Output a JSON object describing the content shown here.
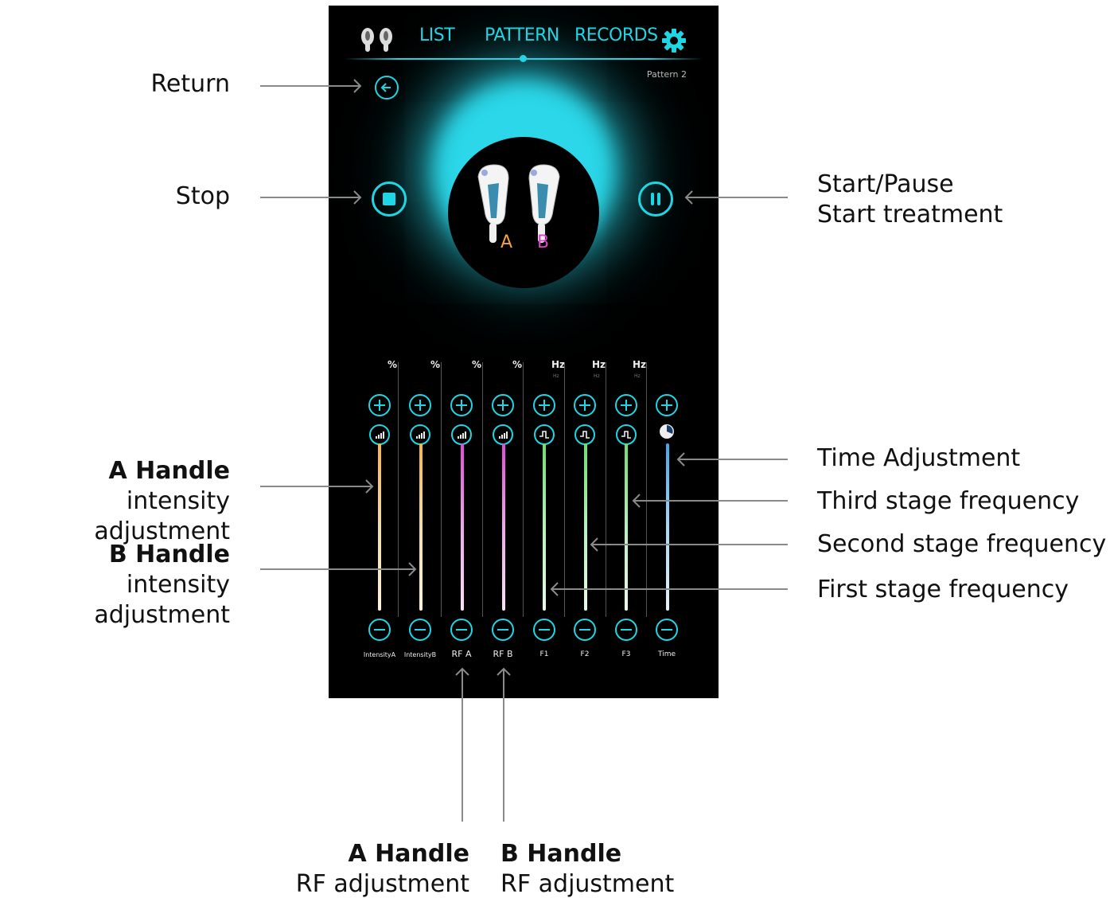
{
  "app": {
    "tabs": [
      "LIST",
      "PATTERN",
      "RECORDS"
    ],
    "active_tab": "PATTERN",
    "pattern_label": "Pattern 2",
    "handle_labels": [
      "A",
      "B"
    ],
    "units": [
      "%",
      "%",
      "%",
      "%",
      "Hz",
      "Hz",
      "Hz"
    ],
    "unit_sub": [
      "",
      "",
      "",
      "",
      "Hz",
      "Hz",
      "Hz"
    ],
    "controls": [
      "IntensityA",
      "IntensityB",
      "RF A",
      "RF B",
      "F1",
      "F2",
      "F3",
      "Time"
    ],
    "colors": {
      "accent": "#1fd6e4",
      "handle_a": "#f2a33a",
      "handle_b": "#e040c8",
      "intensity": "#f0b84a",
      "rf": "#e55ae0",
      "freq": "#7de27f",
      "time": "#3fa8e8"
    },
    "icons": {
      "handles": "handles-icon",
      "settings": "gear-icon",
      "return": "arrow-left-circle-icon",
      "stop": "stop-icon",
      "pause": "pause-icon",
      "plus": "plus-icon",
      "minus": "minus-icon",
      "intensity": "signal-bars-icon",
      "frequency": "square-wave-icon",
      "time": "clock-icon"
    }
  },
  "annotations": {
    "return": "Return",
    "stop": "Stop",
    "start_pause": [
      "Start/Pause",
      "Start treatment"
    ],
    "a_intensity": {
      "title": "A Handle",
      "sub": "intensity adjustment"
    },
    "b_intensity": {
      "title": "B Handle",
      "sub": "intensity adjustment"
    },
    "time": "Time Adjustment",
    "third": "Third stage frequency",
    "second": "Second stage frequency",
    "first": "First stage frequency",
    "a_rf": {
      "title": "A Handle",
      "sub": "RF adjustment"
    },
    "b_rf": {
      "title": "B Handle",
      "sub": "RF adjustment"
    }
  }
}
